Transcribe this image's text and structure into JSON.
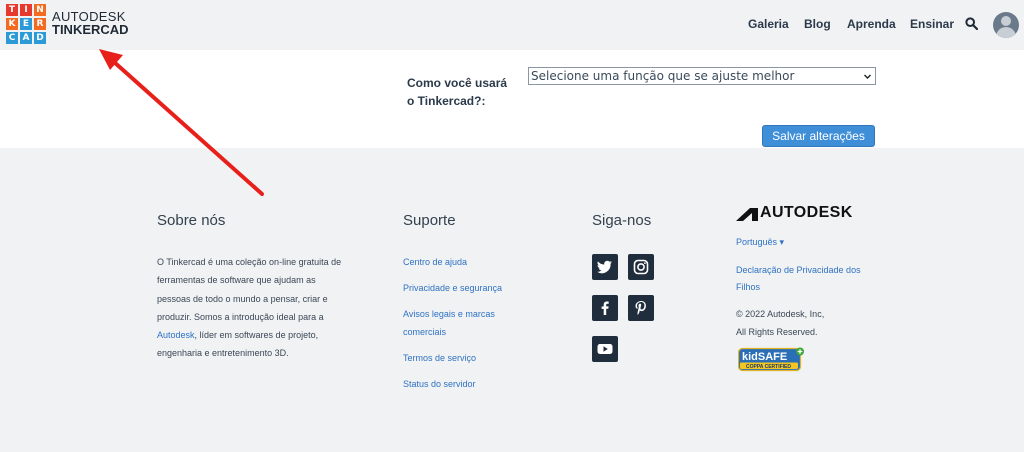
{
  "brand": {
    "logo_letters": [
      "T",
      "I",
      "N",
      "K",
      "E",
      "R",
      "C",
      "A",
      "D"
    ],
    "logo_colors": [
      "#e8392f",
      "#e8392f",
      "#f26b21",
      "#f26b21",
      "#2c9ad6",
      "#f26b21",
      "#2c9ad6",
      "#2c9ad6",
      "#2c9ad6"
    ],
    "line1": "AUTODESK",
    "line2": "TINKERCAD"
  },
  "nav": {
    "items": [
      "Galeria",
      "Blog",
      "Aprenda",
      "Ensinar"
    ]
  },
  "form": {
    "label": "Como você usará o Tinkercad?:",
    "select_value": "Selecione uma função que se ajuste melhor",
    "save_label": "Salvar alterações"
  },
  "footer": {
    "about": {
      "heading": "Sobre nós",
      "text_before": "O Tinkercad é uma coleção on-line gratuita de ferramentas de software que ajudam as pessoas de todo o mundo a pensar, criar e produzir. Somos a introdução ideal para a ",
      "link": "Autodesk",
      "text_after": ", líder em softwares de projeto, engenharia e entretenimento 3D."
    },
    "support": {
      "heading": "Suporte",
      "links": [
        "Centro de ajuda",
        "Privacidade e segurança",
        "Avisos legais e marcas comerciais",
        "Termos de serviço",
        "Status do servidor"
      ]
    },
    "follow": {
      "heading": "Siga-nos",
      "icons": [
        "twitter-icon",
        "instagram-icon",
        "facebook-icon",
        "pinterest-icon",
        "youtube-icon"
      ]
    },
    "autodesk": {
      "logo_text": "AUTODESK",
      "language": "Português ▾",
      "privacy": "Declaração de Privacidade dos Filhos",
      "copyright_line1": "© 2022 Autodesk, Inc,",
      "copyright_line2": "All Rights Reserved.",
      "kidsafe_main": "kidSAFE",
      "kidsafe_sub": "COPPA CERTIFIED"
    }
  },
  "colors": {
    "accent": "#3f8fd8",
    "link": "#2e72c2",
    "arrow": "#e8201c"
  }
}
